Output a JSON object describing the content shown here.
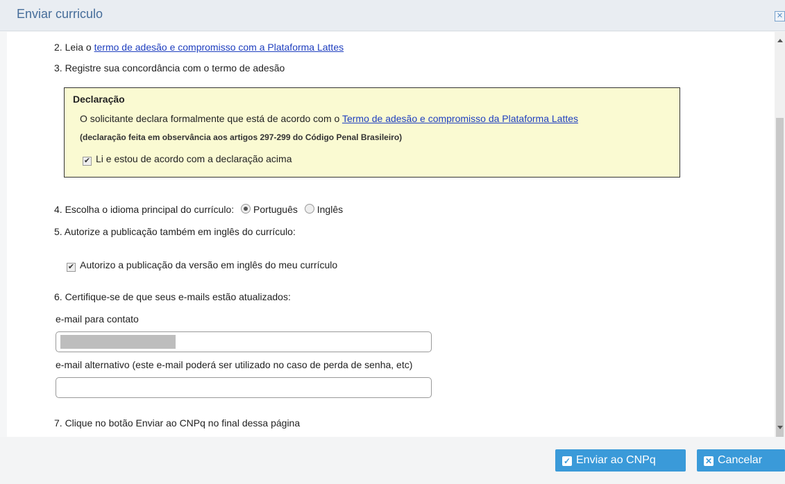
{
  "dialog": {
    "title": "Enviar curriculo",
    "close_icon": "close-icon"
  },
  "step2": {
    "prefix": "2. Leia o ",
    "link": "termo de adesão e compromisso com a Plataforma Lattes"
  },
  "step3": {
    "text": "3. Registre sua concordância com o termo de adesão"
  },
  "declaration": {
    "title": "Declaração",
    "text_prefix": "O solicitante declara formalmente que está de acordo com o ",
    "text_link": "Termo de adesão e compromisso da Plataforma Lattes",
    "note": "(declaração feita em observância aos artigos 297-299 do Código Penal Brasileiro)",
    "checkbox_label": "Li e estou de acordo com a declaração acima",
    "checked": true
  },
  "step4": {
    "text": "4. Escolha o idioma principal do currículo:",
    "options": [
      "Português",
      "Inglês"
    ],
    "selected": "Português"
  },
  "step5": {
    "text": "5. Autorize a publicação também em inglês do currículo:",
    "checkbox_label": "Autorizo a publicação da versão em inglês do meu currículo",
    "checked": true
  },
  "step6": {
    "text": "6. Certifique-se de que seus e-mails estão atualizados:",
    "email_label": "e-mail para contato",
    "email_value": "",
    "alt_email_label": "e-mail alternativo (este e-mail poderá ser utilizado no caso de perda de senha, etc)",
    "alt_email_value": ""
  },
  "step7": {
    "text": "7. Clique no botão Enviar ao CNPq no final dessa página"
  },
  "buttons": {
    "send": "Enviar ao CNPq",
    "cancel": "Cancelar"
  },
  "colors": {
    "accent": "#3a9ad9",
    "title": "#466d9a",
    "declaration_bg": "#fafad2",
    "link": "#1f3fbf"
  }
}
